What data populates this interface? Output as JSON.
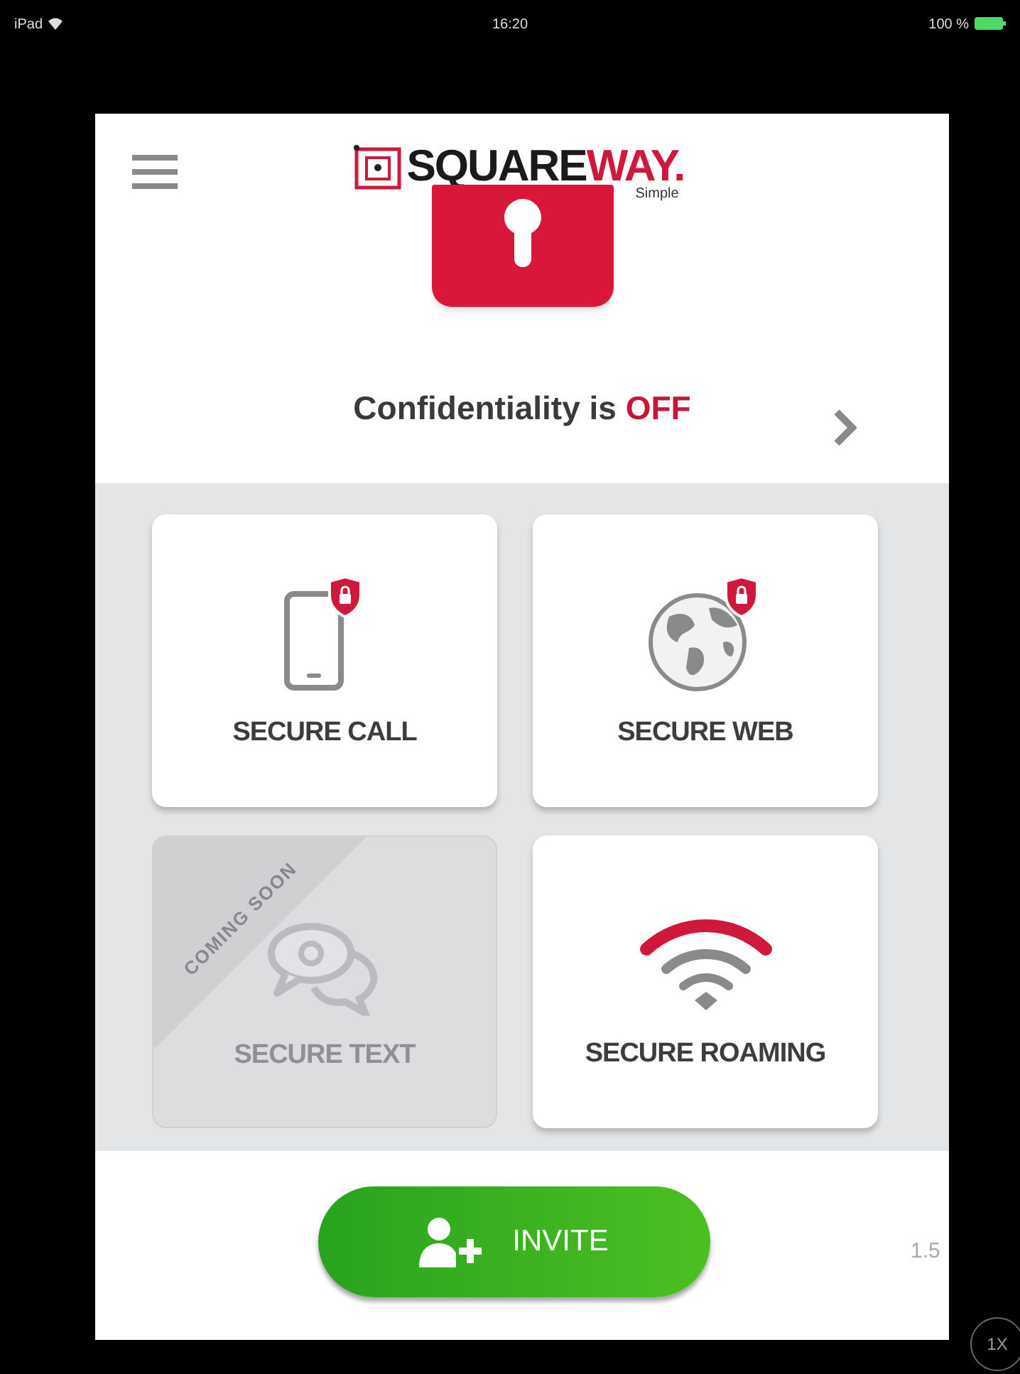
{
  "status_bar": {
    "device": "iPad",
    "time": "16:20",
    "battery": "100 %"
  },
  "header": {
    "logo_dark": "SQUARE",
    "logo_accent": "WAY.",
    "tagline": "Simple",
    "status_label": "Confidentiality is",
    "status_value": "OFF",
    "on": false
  },
  "tiles": [
    {
      "label": "SECURE CALL",
      "kind": "call",
      "disabled": false
    },
    {
      "label": "SECURE WEB",
      "kind": "web",
      "disabled": false
    },
    {
      "label": "SECURE TEXT",
      "kind": "text",
      "disabled": true,
      "ribbon": "COMING SOON"
    },
    {
      "label": "SECURE ROAMING",
      "kind": "roaming",
      "disabled": false
    }
  ],
  "footer": {
    "invite": "INVITE",
    "version": "1.5"
  },
  "zoom_badge": "1X"
}
